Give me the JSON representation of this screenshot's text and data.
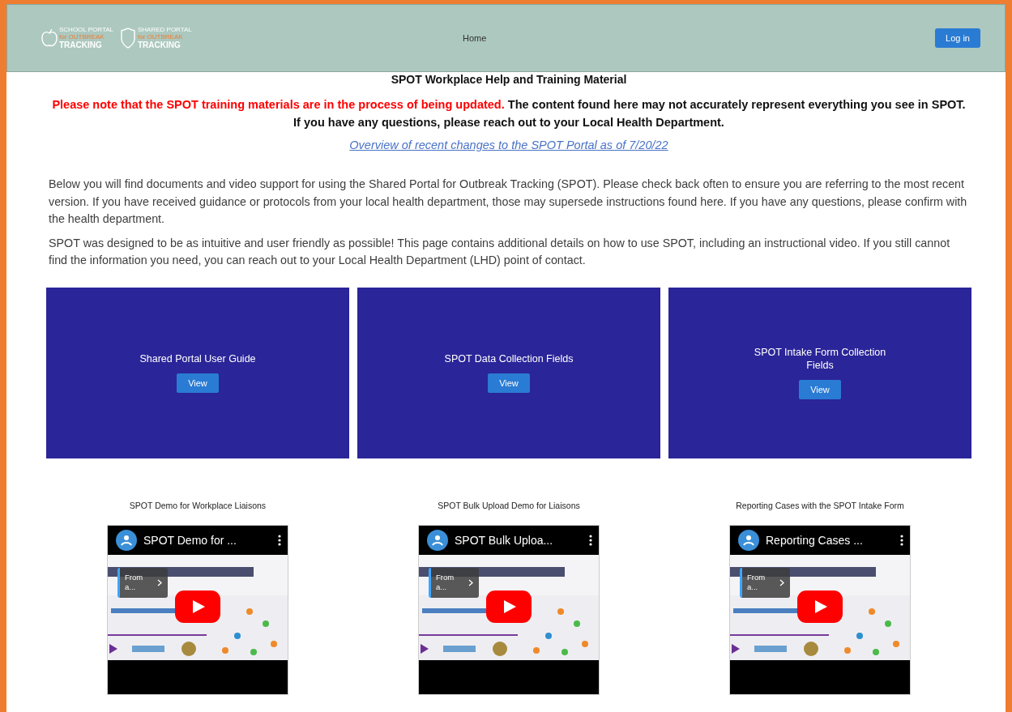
{
  "header": {
    "logos": [
      {
        "lines": [
          "SCHOOL PORTAL",
          "for OUTBREAK",
          "TRACKING"
        ],
        "kind": "apple"
      },
      {
        "lines": [
          "SHARED PORTAL",
          "for OUTBREAK",
          "TRACKING"
        ],
        "kind": "shield"
      }
    ],
    "nav": [
      {
        "label": "Home"
      }
    ],
    "login": "Log in"
  },
  "title": "SPOT Workplace Help and Training Material",
  "notice": {
    "red": "Please note that the SPOT training materials are in the process of being updated.",
    "rest": " The content found here may not accurately represent everything you see in SPOT. If you have any questions, please reach out to your Local Health Department."
  },
  "link": "Overview of recent changes to the SPOT Portal as of 7/20/22",
  "paragraphs": [
    "Below you will find documents and video support for using the Shared Portal for Outbreak Tracking (SPOT).  Please check back often to ensure you are referring to the most recent version. If you have received guidance or protocols from your local health department, those may supersede instructions found here. If you have any questions, please confirm with the health department.",
    "SPOT was designed to be as intuitive and user friendly as possible! This page contains additional details on how to use SPOT, including an instructional video. If you still cannot find the information you need, you can reach out to your Local Health Department (LHD) point of contact."
  ],
  "documents": [
    {
      "title": "Shared Portal User Guide",
      "button": "View"
    },
    {
      "title": "SPOT Data Collection Fields",
      "button": "View"
    },
    {
      "title": "SPOT Intake Form Collection Fields",
      "button": "View"
    }
  ],
  "videos": [
    {
      "caption": "SPOT Demo for Workplace Liaisons",
      "player_title": "SPOT Demo for ...",
      "chip": "From a..."
    },
    {
      "caption": "SPOT Bulk Upload Demo for Liaisons",
      "player_title": "SPOT Bulk Uploa...",
      "chip": "From a..."
    },
    {
      "caption": "Reporting Cases with the SPOT Intake Form",
      "player_title": "Reporting Cases ...",
      "chip": "From a..."
    }
  ]
}
